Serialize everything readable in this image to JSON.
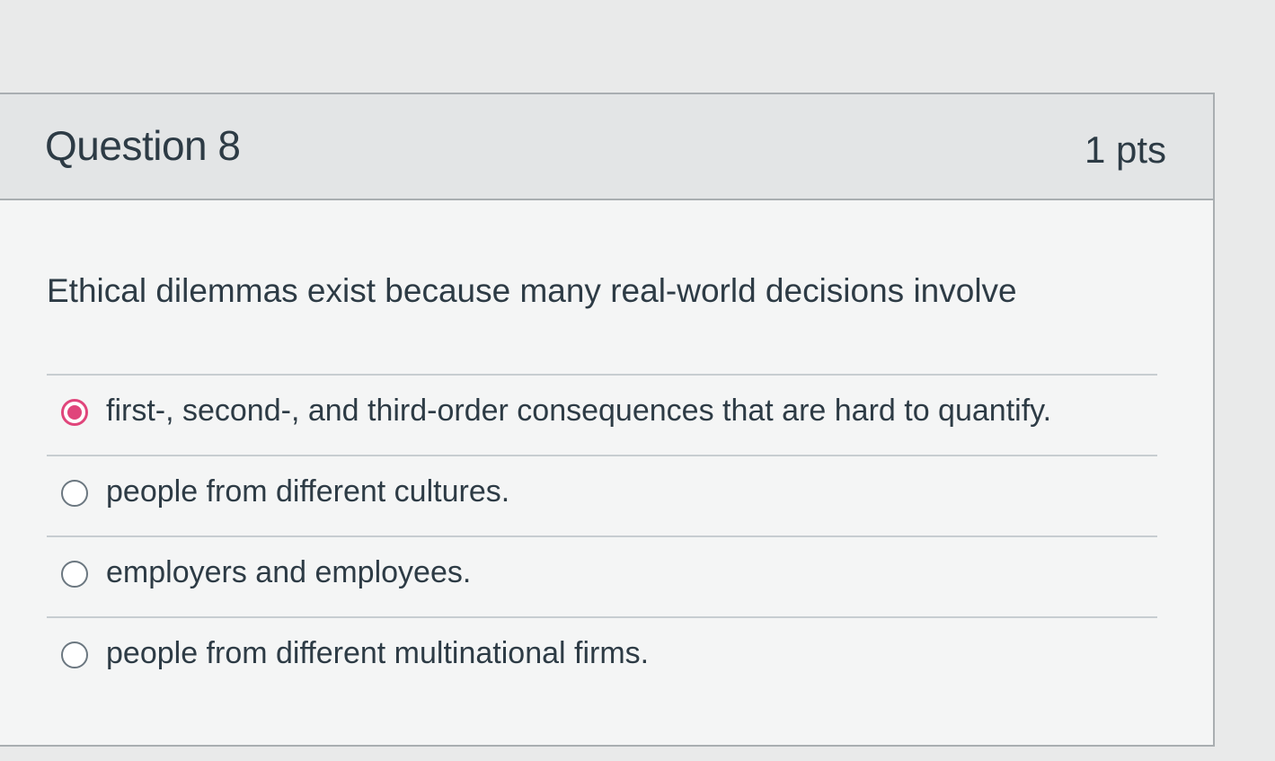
{
  "question": {
    "title": "Question 8",
    "points": "1 pts",
    "text": "Ethical dilemmas exist because many real-world decisions involve",
    "answers": [
      {
        "label": "first-, second-, and third-order consequences that are hard to quantify.",
        "selected": true
      },
      {
        "label": "people from different cultures.",
        "selected": false
      },
      {
        "label": "employers and employees.",
        "selected": false
      },
      {
        "label": "people from different multinational firms.",
        "selected": false
      }
    ]
  },
  "colors": {
    "selected_radio": "#e0457b",
    "text": "#2d3b45",
    "border": "#a9aeb1"
  }
}
